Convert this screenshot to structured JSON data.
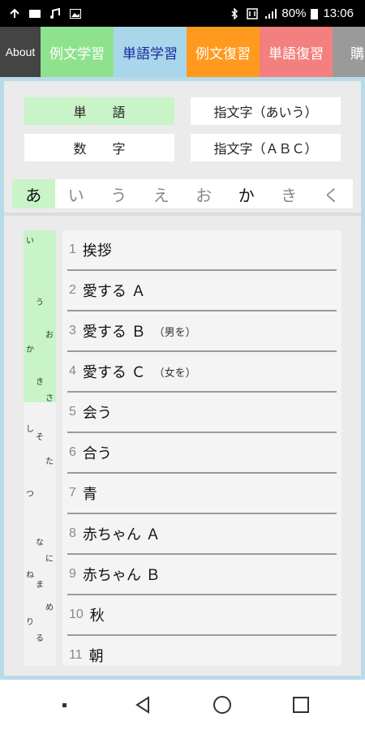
{
  "status": {
    "battery": "80%",
    "time": "13:06"
  },
  "tabs": {
    "about": "About",
    "example_study": "例文学習",
    "word_study": "単語学習",
    "example_review": "例文復習",
    "word_review": "単語復習",
    "purchase": "購"
  },
  "categories": {
    "words": "単　　語",
    "fingerspell_aiu": "指文字（あいう）",
    "numbers": "数　　字",
    "fingerspell_abc": "指文字（ＡＢＣ）"
  },
  "kana_tabs": [
    "あ",
    "い",
    "う",
    "え",
    "お",
    "か",
    "き",
    "く"
  ],
  "index_chars": [
    "い",
    "う",
    "お",
    "か",
    "き",
    "さ",
    "し",
    "そ",
    "た",
    "つ",
    "な",
    "に",
    "ね",
    "ま",
    "め",
    "り",
    "る"
  ],
  "words": [
    {
      "num": "1",
      "word": "挨拶",
      "note": ""
    },
    {
      "num": "2",
      "word": "愛する Ａ",
      "note": ""
    },
    {
      "num": "3",
      "word": "愛する Ｂ",
      "note": "（男を）"
    },
    {
      "num": "4",
      "word": "愛する Ｃ",
      "note": "（女を）"
    },
    {
      "num": "5",
      "word": "会う",
      "note": ""
    },
    {
      "num": "6",
      "word": "合う",
      "note": ""
    },
    {
      "num": "7",
      "word": "青",
      "note": ""
    },
    {
      "num": "8",
      "word": "赤ちゃん Ａ",
      "note": ""
    },
    {
      "num": "9",
      "word": "赤ちゃん Ｂ",
      "note": ""
    },
    {
      "num": "10",
      "word": "秋",
      "note": ""
    },
    {
      "num": "11",
      "word": "朝",
      "note": ""
    }
  ]
}
